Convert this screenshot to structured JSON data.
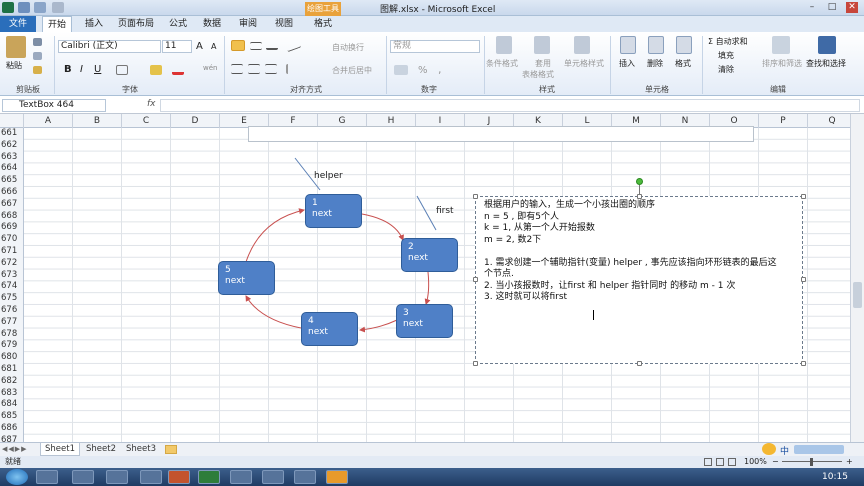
{
  "window": {
    "title": "图解.xlsx - Microsoft Excel",
    "min": "–",
    "max": "□",
    "close": "✕"
  },
  "ribbon": {
    "context_group": "绘图工具",
    "tabs": [
      "文件",
      "开始",
      "插入",
      "页面布局",
      "公式",
      "数据",
      "审阅",
      "视图",
      "格式"
    ],
    "clipboard": {
      "paste": "粘贴",
      "group": "剪贴板"
    },
    "font": {
      "name": "Calibri (正文)",
      "size": "11",
      "grow": "A",
      "shrink": "A",
      "bold": "B",
      "italic": "I",
      "underline": "U",
      "wen": "wén",
      "group": "字体"
    },
    "alignment": {
      "wrap": "自动换行",
      "merge": "合并后居中",
      "group": "对齐方式"
    },
    "number": {
      "format": "常规",
      "pct": "%",
      "comma": ",",
      "group": "数字"
    },
    "styles": {
      "cond": "条件格式",
      "table": "套用",
      "table2": "表格格式",
      "cell": "单元格样式",
      "group": "样式"
    },
    "cells": {
      "insert": "插入",
      "delete": "删除",
      "format": "格式",
      "group": "单元格"
    },
    "editing": {
      "autosum": "Σ 自动求和",
      "fill": "填充",
      "clear": "清除",
      "sort": "排序和筛选",
      "find": "查找和选择",
      "group": "编辑"
    }
  },
  "formula_bar": {
    "name_box": "TextBox 464",
    "fx": "fx",
    "value": ""
  },
  "columns": [
    "A",
    "B",
    "C",
    "D",
    "E",
    "F",
    "G",
    "H",
    "I",
    "J",
    "K",
    "L",
    "M",
    "N",
    "O",
    "P",
    "Q"
  ],
  "rows": [
    "661",
    "662",
    "663",
    "664",
    "665",
    "666",
    "667",
    "668",
    "669",
    "670",
    "671",
    "672",
    "673",
    "674",
    "675",
    "676",
    "677",
    "678",
    "679",
    "680",
    "681",
    "682",
    "683",
    "684",
    "685",
    "686",
    "687"
  ],
  "diagram": {
    "nodes": [
      {
        "num": "1",
        "label": "next"
      },
      {
        "num": "2",
        "label": "next"
      },
      {
        "num": "3",
        "label": "next"
      },
      {
        "num": "4",
        "label": "next"
      },
      {
        "num": "5",
        "label": "next"
      }
    ],
    "pointer_helper": "helper",
    "pointer_first": "first"
  },
  "textbox": {
    "lines": [
      "根据用户的输入，生成一个小孩出圈的顺序",
      "n = 5 , 即有5个人",
      "k = 1, 从第一个人开始报数",
      "m = 2, 数2下",
      "",
      "1.  需求创建一个辅助指针(变量) helper , 事先应该指向环形链表的最后这",
      "个节点.",
      "2.  当小孩报数时，让first 和 helper 指针同时 的移动  m  - 1 次",
      "3.  这时就可以将first"
    ]
  },
  "sheets": [
    "Sheet1",
    "Sheet2",
    "Sheet3"
  ],
  "status": {
    "ready": "就绪",
    "zoom": "100%",
    "minus": "−",
    "plus": "+"
  },
  "ime": {
    "lang": "中"
  },
  "taskbar": {
    "time": "10:15"
  },
  "colors": {
    "accent": "#2a6ebb",
    "node": "#4f80c7",
    "arrow": "#c8504f"
  }
}
